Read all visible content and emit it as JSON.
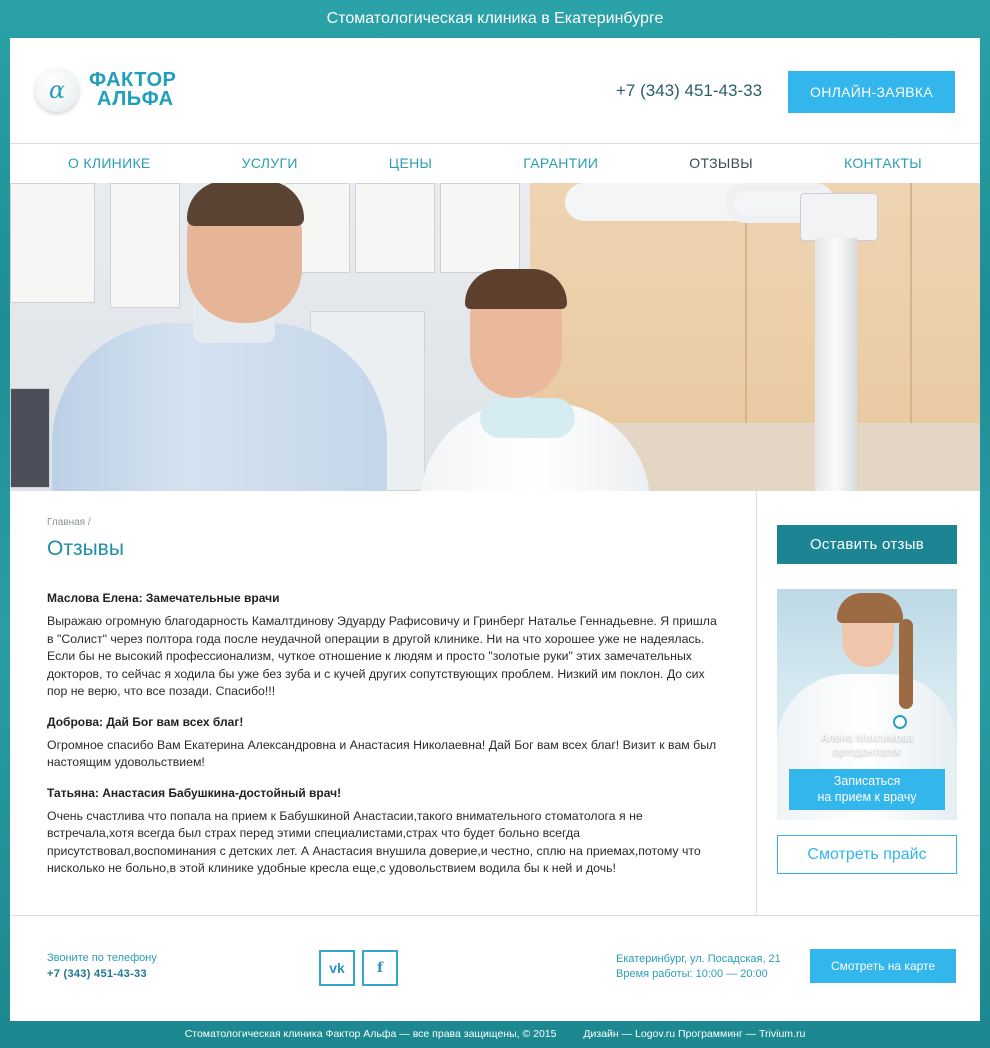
{
  "topbar": {
    "title": "Стоматологическая клиника в Екатеринбурге"
  },
  "header": {
    "logo_line1": "ФАКТОР",
    "logo_line2": "АЛЬФА",
    "logo_symbol": "α",
    "phone": "+7 (343) 451-43-33",
    "cta_label": "ОНЛАЙН-ЗАЯВКА"
  },
  "nav": {
    "items": [
      {
        "label": "О КЛИНИКЕ"
      },
      {
        "label": "УСЛУГИ"
      },
      {
        "label": "ЦЕНЫ"
      },
      {
        "label": "ГАРАНТИИ"
      },
      {
        "label": "ОТЗЫВЫ",
        "active": true
      },
      {
        "label": "КОНТАКТЫ"
      }
    ]
  },
  "main": {
    "breadcrumb": "Главная /",
    "title": "Отзывы",
    "reviews": [
      {
        "title": "Маслова Елена: Замечательные врачи",
        "text": "Выражаю огромную благодарность Камалтдинову Эдуарду Рафисовичу и Гринберг Наталье Геннадьевне. Я пришла в \"Солист\" через полтора года после неудачной операции в другой клинике. Ни на что хорошее уже не надеялась. Если бы не высокий профессионализм, чуткое отношение к людям и просто \"золотые руки\" этих замечательных докторов, то сейчас я ходила бы уже без зуба и с кучей других сопутствующих проблем. Низкий им поклон. До сих пор не верю, что все позади. Спасибо!!!"
      },
      {
        "title": "Доброва: Дай Бог вам всех благ!",
        "text": "Огромное спасибо Вам Екатерина Александровна и Анастасия Николаевна! Дай Бог вам всех благ! Визит к вам был настоящим удовольствием!"
      },
      {
        "title": "Татьяна: Анастасия Бабушкина-достойный врач!",
        "text": "Очень счастлива что попала на прием к Бабушкиной Анастасии,такого внимательного стоматолога я не встречала,хотя всегда был страх перед этими специалистами,страх что будет больно всегда присутствовал,воспоминания с детских лет. А Анастасия внушила доверие,и честно, сплю на приемах,потому что нисколько не больно,в этой клинике удобные кресла еще,с удовольствием водила бы к ней и дочь!"
      }
    ]
  },
  "sidebar": {
    "feedback_button": "Оставить отзыв",
    "doctor_name": "Алена Максимова",
    "doctor_role": "ортодонтолог",
    "appointment_line1": "Записаться",
    "appointment_line2": "на прием к врачу",
    "price_button": "Смотреть прайс"
  },
  "footer": {
    "call_label": "Звоните по телефону",
    "phone": "+7 (343) 451-43-33",
    "vk_label": "vk",
    "fb_label": "f",
    "address": "Екатеринбург, ул. Посадская, 21",
    "hours": "Время работы: 10:00 — 20:00",
    "map_button": "Смотреть на карте"
  },
  "bottombar": {
    "copyright": "Стоматологическая клиника Фактор Альфа — все права защищены, © 2015",
    "credits": "Дизайн — Logov.ru Программинг — Trivium.ru"
  },
  "colors": {
    "accent": "#32b6ec",
    "teal": "#1c8593",
    "link": "#2a9eb5",
    "background": "#2aa3a8"
  }
}
